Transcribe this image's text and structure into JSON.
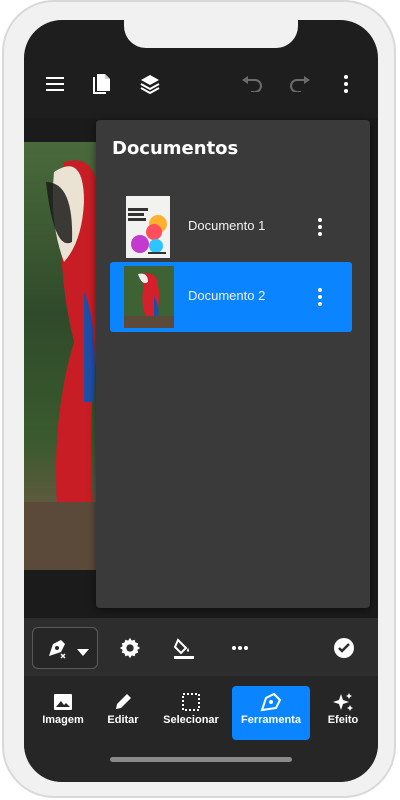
{
  "topbar": {
    "icons": [
      "menu-icon",
      "documents-icon",
      "layers-icon",
      "undo-icon",
      "redo-icon",
      "more-vertical-icon"
    ]
  },
  "documents_panel": {
    "title": "Documentos",
    "items": [
      {
        "label": "Documento 1",
        "thumbnail": "poster-thumbnail",
        "active": false
      },
      {
        "label": "Documento 2",
        "thumbnail": "parrot-thumbnail",
        "active": true
      }
    ]
  },
  "tool_bar": {
    "icons": [
      "pen-tool-icon",
      "chevron-down-icon",
      "settings-icon",
      "fill-icon",
      "more-horizontal-icon",
      "check-circle-icon"
    ]
  },
  "bottom_nav": {
    "items": [
      {
        "label": "Imagem",
        "icon": "image-icon",
        "active": false
      },
      {
        "label": "Editar",
        "icon": "pencil-icon",
        "active": false
      },
      {
        "label": "Selecionar",
        "icon": "selection-icon",
        "active": false
      },
      {
        "label": "Ferramenta",
        "icon": "pen-icon",
        "active": true
      },
      {
        "label": "Efeito",
        "icon": "sparkle-icon",
        "active": false
      }
    ]
  },
  "colors": {
    "accent": "#0a84ff",
    "panel": "#3a3a3a",
    "background": "#1e1e1e"
  }
}
